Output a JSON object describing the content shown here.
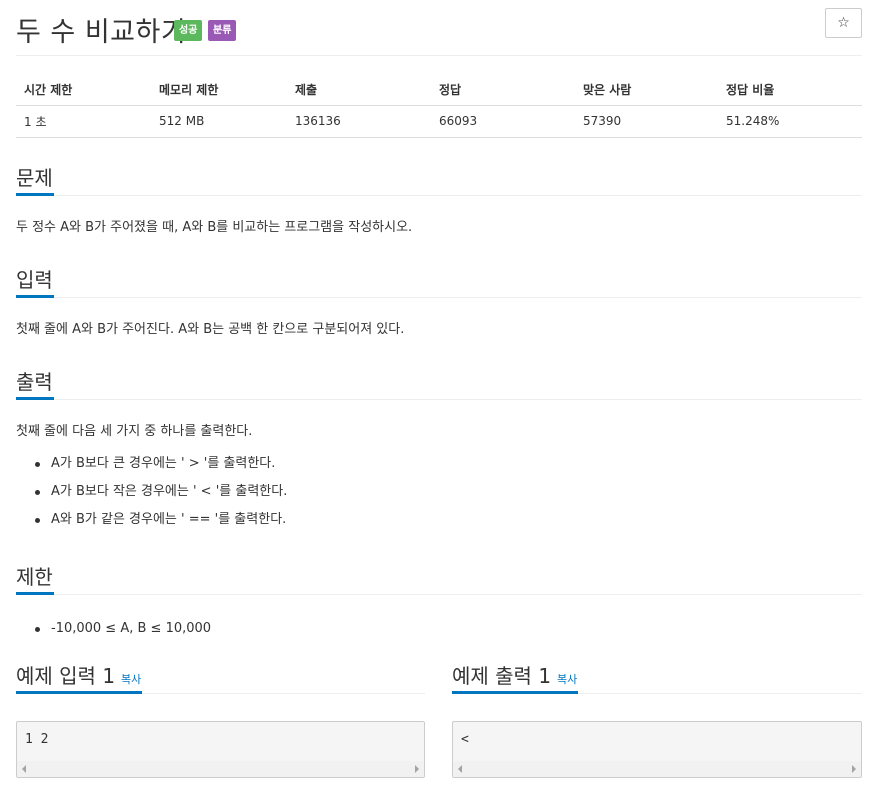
{
  "problem": {
    "title": "두 수 비교하기",
    "badge_success": "성공",
    "badge_category": "분류",
    "star": "☆"
  },
  "info_table": {
    "headers": [
      "시간 제한",
      "메모리 제한",
      "제출",
      "정답",
      "맞은 사람",
      "정답 비율"
    ],
    "values": [
      "1 초",
      "512 MB",
      "136136",
      "66093",
      "57390",
      "51.248%"
    ]
  },
  "sections": {
    "description": {
      "title": "문제",
      "text": "두 정수 A와 B가 주어졌을 때, A와 B를 비교하는 프로그램을 작성하시오."
    },
    "input": {
      "title": "입력",
      "text": "첫째 줄에 A와 B가 주어진다. A와 B는 공백 한 칸으로 구분되어져 있다."
    },
    "output": {
      "title": "출력",
      "text": "첫째 줄에 다음 세 가지 중 하나를 출력한다.",
      "items": [
        "A가 B보다 큰 경우에는 ' > '를 출력한다.",
        "A가 B보다 작은 경우에는 ' < '를 출력한다.",
        "A와 B가 같은 경우에는 ' == '를 출력한다."
      ]
    },
    "limit": {
      "title": "제한",
      "items": [
        "-10,000 ≤ A, B ≤ 10,000"
      ]
    }
  },
  "samples": {
    "input": {
      "title": "예제 입력 1",
      "copy": "복사",
      "content": "1 2"
    },
    "output": {
      "title": "예제 출력 1",
      "copy": "복사",
      "content": "<"
    }
  },
  "colors": {
    "accent": "#0076c0",
    "success": "#5cb85c",
    "category": "#9b59b6"
  }
}
